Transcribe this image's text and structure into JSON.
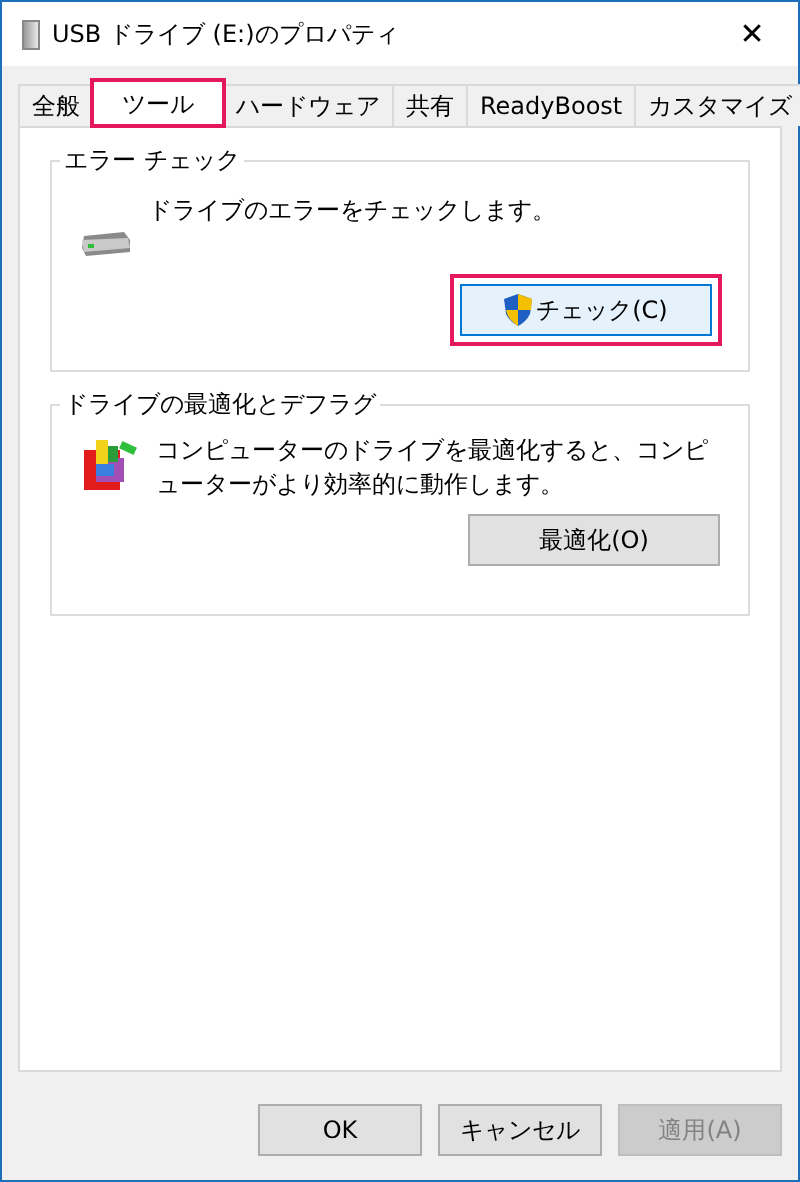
{
  "window": {
    "title": "USB ドライブ (E:)のプロパティ",
    "close": "✕"
  },
  "tabs": [
    {
      "label": "全般",
      "selected": false,
      "highlighted": false
    },
    {
      "label": "ツール",
      "selected": true,
      "highlighted": true
    },
    {
      "label": "ハードウェア",
      "selected": false,
      "highlighted": false
    },
    {
      "label": "共有",
      "selected": false,
      "highlighted": false
    },
    {
      "label": "ReadyBoost",
      "selected": false,
      "highlighted": false
    },
    {
      "label": "カスタマイズ",
      "selected": false,
      "highlighted": false
    }
  ],
  "groups": [
    {
      "kind": "check",
      "title": "エラー チェック",
      "text": "ドライブのエラーをチェックします。",
      "button": {
        "label": "チェック(C)",
        "shield": true,
        "highlighted": true,
        "focused": true
      }
    },
    {
      "kind": "optimize",
      "title": "ドライブの最適化とデフラグ",
      "text": "コンピューターのドライブを最適化すると、コンピューターがより効率的に動作します。",
      "button": {
        "label": "最適化(O)",
        "shield": false,
        "highlighted": false,
        "focused": false
      }
    }
  ],
  "buttons": [
    {
      "label": "OK",
      "disabled": false
    },
    {
      "label": "キャンセル",
      "disabled": false
    },
    {
      "label": "適用(A)",
      "disabled": true
    }
  ]
}
